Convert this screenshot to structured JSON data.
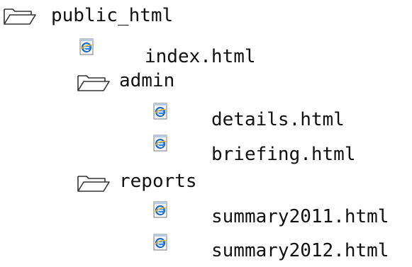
{
  "tree": {
    "root": {
      "label": "public_html",
      "icon": "folder-open-icon"
    },
    "index": {
      "label": "index.html",
      "icon": "ie-document-icon"
    },
    "admin": {
      "label": "admin",
      "icon": "folder-open-icon",
      "details": {
        "label": "details.html",
        "icon": "ie-document-icon"
      },
      "briefing": {
        "label": "briefing.html",
        "icon": "ie-document-icon"
      }
    },
    "reports": {
      "label": "reports",
      "icon": "folder-open-icon",
      "summary2011": {
        "label": "summary2011.html",
        "icon": "ie-document-icon"
      },
      "summary2012": {
        "label": "summary2012.html",
        "icon": "ie-document-icon"
      }
    }
  },
  "colors": {
    "folder_outline": "#333333",
    "ie_blue": "#1a6fd1",
    "page_white": "#ffffff",
    "page_border": "#7a7a7a"
  }
}
